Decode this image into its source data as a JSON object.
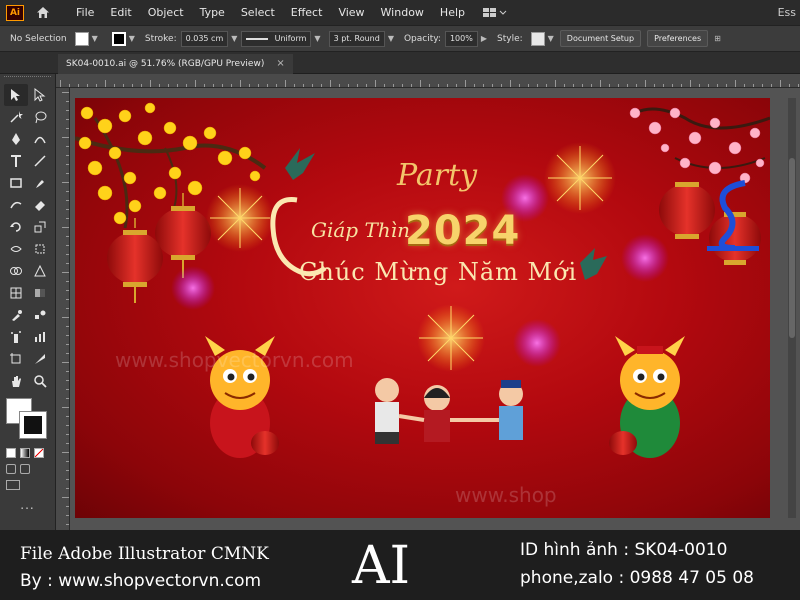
{
  "app": {
    "logo_text": "Ai",
    "partial_right_label": "Ess"
  },
  "menu": {
    "items": [
      "File",
      "Edit",
      "Object",
      "Type",
      "Select",
      "Effect",
      "View",
      "Window",
      "Help"
    ]
  },
  "control_bar": {
    "selection_label": "No Selection",
    "stroke_label": "Stroke:",
    "stroke_weight": "0.035 cm",
    "stroke_profile": "Uniform",
    "brush": "3 pt. Round",
    "opacity_label": "Opacity:",
    "opacity_value": "100%",
    "style_label": "Style:",
    "document_setup": "Document Setup",
    "preferences": "Preferences"
  },
  "document_tab": {
    "title": "SK04-0010.ai @ 51.76% (RGB/GPU Preview)",
    "close": "×"
  },
  "toolbar": {
    "tools": [
      "selection-icon",
      "direct-selection-icon",
      "magic-wand-icon",
      "lasso-icon",
      "pen-icon",
      "curvature-icon",
      "type-icon",
      "line-icon",
      "rectangle-icon",
      "paintbrush-icon",
      "shaper-icon",
      "eraser-icon",
      "rotate-icon",
      "scale-icon",
      "width-icon",
      "free-transform-icon",
      "shape-builder-icon",
      "perspective-icon",
      "mesh-icon",
      "gradient-icon",
      "eyedropper-icon",
      "blend-icon",
      "symbol-sprayer-icon",
      "graph-icon",
      "artboard-icon",
      "slice-icon",
      "hand-icon",
      "zoom-icon"
    ],
    "more": "..."
  },
  "artwork": {
    "party": "Party",
    "giap_thin": "Giáp Thìn",
    "year": "2024",
    "main_greeting": "Chúc Mừng Năm Mới",
    "watermark": "www.shopvectorvn.com",
    "watermark_short": "www.shop",
    "colors": {
      "background": "#b3090f",
      "gold": "#f7d36b"
    }
  },
  "banner": {
    "file_line": "File  Adobe Illustrator   CMNK",
    "by_line": "By : www.shopvectorvn.com",
    "ai_mark": "AI",
    "id_line": "ID hình ảnh  : SK04-0010",
    "phone_line": "phone,zalo  : 0988 47 05 08"
  }
}
